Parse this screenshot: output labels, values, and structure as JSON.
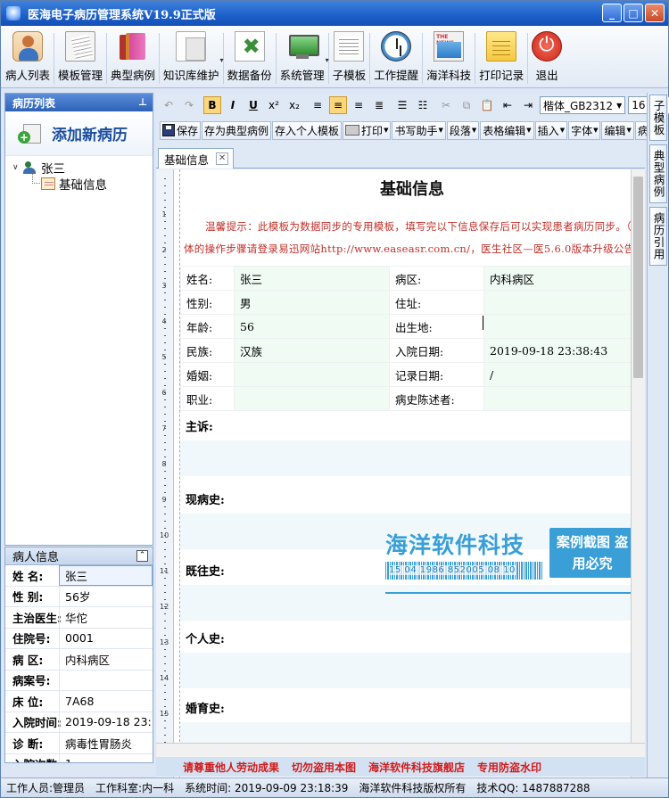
{
  "window": {
    "title": "医海电子病历管理系统V19.9正式版"
  },
  "toolbar": [
    {
      "label": "病人列表",
      "icon": "person-icon",
      "cls": "i-person"
    },
    {
      "label": "模板管理",
      "icon": "template-icon",
      "cls": "i-tpl"
    },
    {
      "label": "典型病例",
      "icon": "books-icon",
      "cls": "i-books"
    },
    {
      "label": "知识库维护",
      "icon": "knowledge-icon",
      "cls": "i-docs"
    },
    {
      "label": "数据备份",
      "icon": "backup-icon",
      "cls": "i-backup"
    },
    {
      "label": "系统管理",
      "icon": "monitor-icon",
      "cls": "i-monitor"
    },
    {
      "label": "子模板",
      "icon": "subtemplate-icon",
      "cls": "i-subtpl"
    },
    {
      "label": "工作提醒",
      "icon": "clock-icon",
      "cls": "i-clock"
    },
    {
      "label": "海洋科技",
      "icon": "news-icon",
      "cls": "i-news"
    },
    {
      "label": "打印记录",
      "icon": "print-record-icon",
      "cls": "i-print"
    },
    {
      "label": "退出",
      "icon": "exit-icon",
      "cls": "i-exit"
    }
  ],
  "left": {
    "header": "病历列表",
    "add_new": "添加新病历",
    "tree": {
      "patient": "张三",
      "child": "基础信息"
    }
  },
  "info": {
    "header": "病人信息",
    "rows": [
      {
        "k": "姓  名:",
        "v": "张三"
      },
      {
        "k": "性  别:",
        "v": "56岁"
      },
      {
        "k": "主治医生:",
        "v": "华佗"
      },
      {
        "k": "住院号:",
        "v": "0001"
      },
      {
        "k": "病  区:",
        "v": "内科病区"
      },
      {
        "k": "病案号:",
        "v": ""
      },
      {
        "k": "床  位:",
        "v": "7A68"
      },
      {
        "k": "入院时间:",
        "v": "2019-09-18 23:"
      },
      {
        "k": "诊  断:",
        "v": "病毒性胃肠炎"
      },
      {
        "k": "入院次数:",
        "v": "1"
      }
    ]
  },
  "format": {
    "font": "楷体_GB2312",
    "size": "16",
    "zoom": "10"
  },
  "commands": [
    "保存",
    "存为典型病例",
    "存入个人模板",
    "打印",
    "书写助手",
    "段落",
    "表格编辑",
    "插入",
    "字体",
    "编辑",
    "病历"
  ],
  "tab": {
    "label": "基础信息"
  },
  "doc": {
    "title": "基础信息",
    "hint": "温馨提示：此模板为数据同步的专用模板，填写完以下信息保存后可以实现患者病历同步。（具体的操作步骤请登录易迅网站http://www.easeasr.com.cn/，医生社区—医5.6.0版本升级公告）",
    "rows": [
      [
        "姓名:",
        "张三",
        "病区:",
        "内科病区"
      ],
      [
        "性别:",
        "男",
        "住址:",
        ""
      ],
      [
        "年龄:",
        "56",
        "出生地:",
        ""
      ],
      [
        "民族:",
        "汉族",
        "入院日期:",
        "2019-09-18 23:38:43"
      ],
      [
        "婚姻:",
        "",
        "记录日期:",
        "/"
      ],
      [
        "职业:",
        "",
        "病史陈述者:",
        ""
      ]
    ],
    "sections": [
      "主诉:",
      "现病史:",
      "既往史:",
      "个人史:",
      "婚育史:"
    ]
  },
  "watermark": {
    "company": "海洋软件科技",
    "code": "15 04 1986 852005 08 10",
    "stamp": "案例截图 盗用必究",
    "bottom": [
      "请尊重他人劳动成果",
      "切勿盗用本图",
      "海洋软件科技旗舰店",
      "专用防盗水印"
    ]
  },
  "right_tabs": [
    "子模板",
    "典型病例",
    "病历引用"
  ],
  "status": {
    "user": "工作人员:管理员",
    "dept": "工作科室:内一科",
    "time": "系统时间:  2019-09-09  23:18:39",
    "copyright": "海洋软件科技版权所有",
    "qq": "技术QQ: 1487887288"
  }
}
